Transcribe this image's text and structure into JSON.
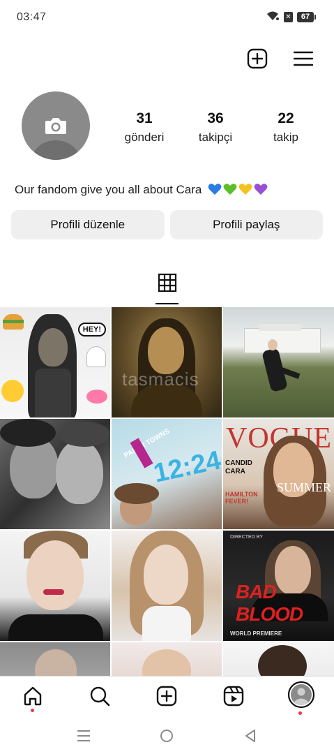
{
  "status_bar": {
    "time": "03:47",
    "battery": "67"
  },
  "top_actions": {
    "create_icon": "plus-square-icon",
    "menu_icon": "hamburger-menu-icon"
  },
  "profile": {
    "avatar_icon": "camera-icon",
    "stats": [
      {
        "number": "31",
        "label": "gönderi"
      },
      {
        "number": "36",
        "label": "takipçi"
      },
      {
        "number": "22",
        "label": "takip"
      }
    ],
    "bio": "Our fandom give you all about Cara",
    "bio_hearts": [
      "#2a7be4",
      "#5cbf2a",
      "#f4c21b",
      "#9b4fd4"
    ]
  },
  "buttons": {
    "edit_profile": "Profili düzenle",
    "share_profile": "Profili paylaş"
  },
  "tabs": {
    "active": "grid-icon"
  },
  "posts": {
    "watermark": "tasmacis",
    "hey_bubble": "HEY!",
    "paper_towns_label": "PAPER TOWNS",
    "paper_towns_time": "12:24",
    "vogue_title": "VOGUE",
    "vogue_candid": "CANDID CARA",
    "vogue_summer": "SUMMER",
    "vogue_hamilton": "HAMILTON FEVER!",
    "bad_blood_title": "BAD BLOOD",
    "bad_blood_premiere": "WORLD PREMIERE"
  },
  "bottom_nav": {
    "items": [
      "home-icon",
      "search-icon",
      "create-icon",
      "reels-icon",
      "profile-icon"
    ]
  },
  "colors": {
    "notification_dot": "#ff3040",
    "button_bg": "#efefef"
  }
}
